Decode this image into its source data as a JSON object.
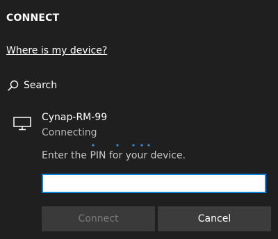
{
  "panel": {
    "title": "CONNECT",
    "where_link": "Where is my device?",
    "search_label": "Search"
  },
  "device": {
    "icon": "monitor-icon",
    "name": "Cynap-RM-99",
    "status": "Connecting",
    "pin_prompt": "Enter the PIN for your device.",
    "pin_value": ""
  },
  "buttons": {
    "connect_label": "Connect",
    "cancel_label": "Cancel"
  },
  "colors": {
    "background": "#1f1f1f",
    "accent": "#0a84d6",
    "button_bg": "#3a3a3a"
  }
}
